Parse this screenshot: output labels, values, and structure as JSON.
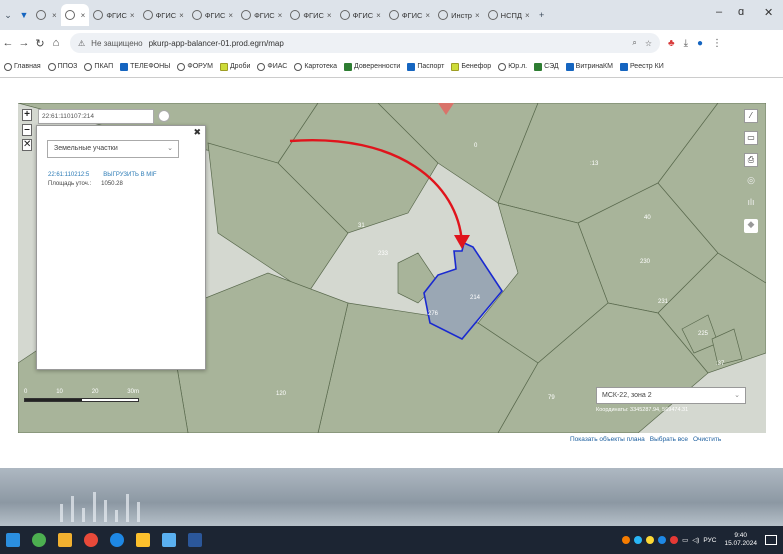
{
  "browser": {
    "tabs": [
      {
        "label": "",
        "active": false
      },
      {
        "label": "",
        "active": true
      },
      {
        "label": "ФГИС",
        "active": false
      },
      {
        "label": "ФГИС",
        "active": false
      },
      {
        "label": "ФГИС",
        "active": false
      },
      {
        "label": "ФГИС",
        "active": false
      },
      {
        "label": "ФГИС",
        "active": false
      },
      {
        "label": "ФГИС",
        "active": false
      },
      {
        "label": "ФГИС",
        "active": false
      },
      {
        "label": "Инстр",
        "active": false
      },
      {
        "label": "НСПД",
        "active": false
      }
    ],
    "new_tab": "+",
    "security_label": "Не защищено",
    "url": "pkurp-app-balancer-01.prod.egrn/map"
  },
  "bookmarks": [
    {
      "label": "Главная",
      "color": "ring"
    },
    {
      "label": "ППОЗ",
      "color": "ring"
    },
    {
      "label": "ПКАП",
      "color": "ring"
    },
    {
      "label": "ТЕЛЕФОНЫ",
      "color": "b"
    },
    {
      "label": "ФОРУМ",
      "color": "ring"
    },
    {
      "label": "Дроби",
      "color": "y"
    },
    {
      "label": "ФИАС",
      "color": "ring"
    },
    {
      "label": "Картотека",
      "color": "ring"
    },
    {
      "label": "Доверенности",
      "color": "g"
    },
    {
      "label": "Паспорт",
      "color": "b"
    },
    {
      "label": "Бенефор",
      "color": "y"
    },
    {
      "label": "Юр.л.",
      "color": "ring"
    },
    {
      "label": "СЭД",
      "color": "g"
    },
    {
      "label": "ВитринаКМ",
      "color": "b"
    },
    {
      "label": "Реестр КИ",
      "color": "b"
    }
  ],
  "map": {
    "coord_input": "22:61:110107:214",
    "layer_panel": {
      "layer_select": "Земельные участки",
      "parcel_number": "22:61:110212:5",
      "export_label": "ВЫГРУЗИТЬ В MIF",
      "area_label": "Площадь уточ.:",
      "area_value": "1050.28"
    },
    "parcel_labels": [
      "0",
      ":13",
      "31",
      "233",
      "214",
      "276",
      "225",
      ":37",
      "120",
      "79",
      "230",
      "231",
      "40"
    ],
    "scale_labels": [
      "0",
      "10",
      "20",
      "30m"
    ],
    "crs_select": "МСК-22, зона 2",
    "coordinates_readout": "Координаты: 3345287.94, 569474.31",
    "bottom_links": {
      "show_plan": "Показать объекты плана",
      "select_all": "Выбрать все",
      "clear": "Очистить"
    }
  },
  "taskbar": {
    "lang": "РУС",
    "time": "9:40",
    "date": "15.07.2024"
  },
  "colors": {
    "parcel": "#a8b49a",
    "parcel_border": "#5a6a4e",
    "selected_parcel": "#9aa7b4",
    "selected_border": "#1a2ad0",
    "arrow": "#e0141c",
    "road": "#d4d8d0"
  }
}
